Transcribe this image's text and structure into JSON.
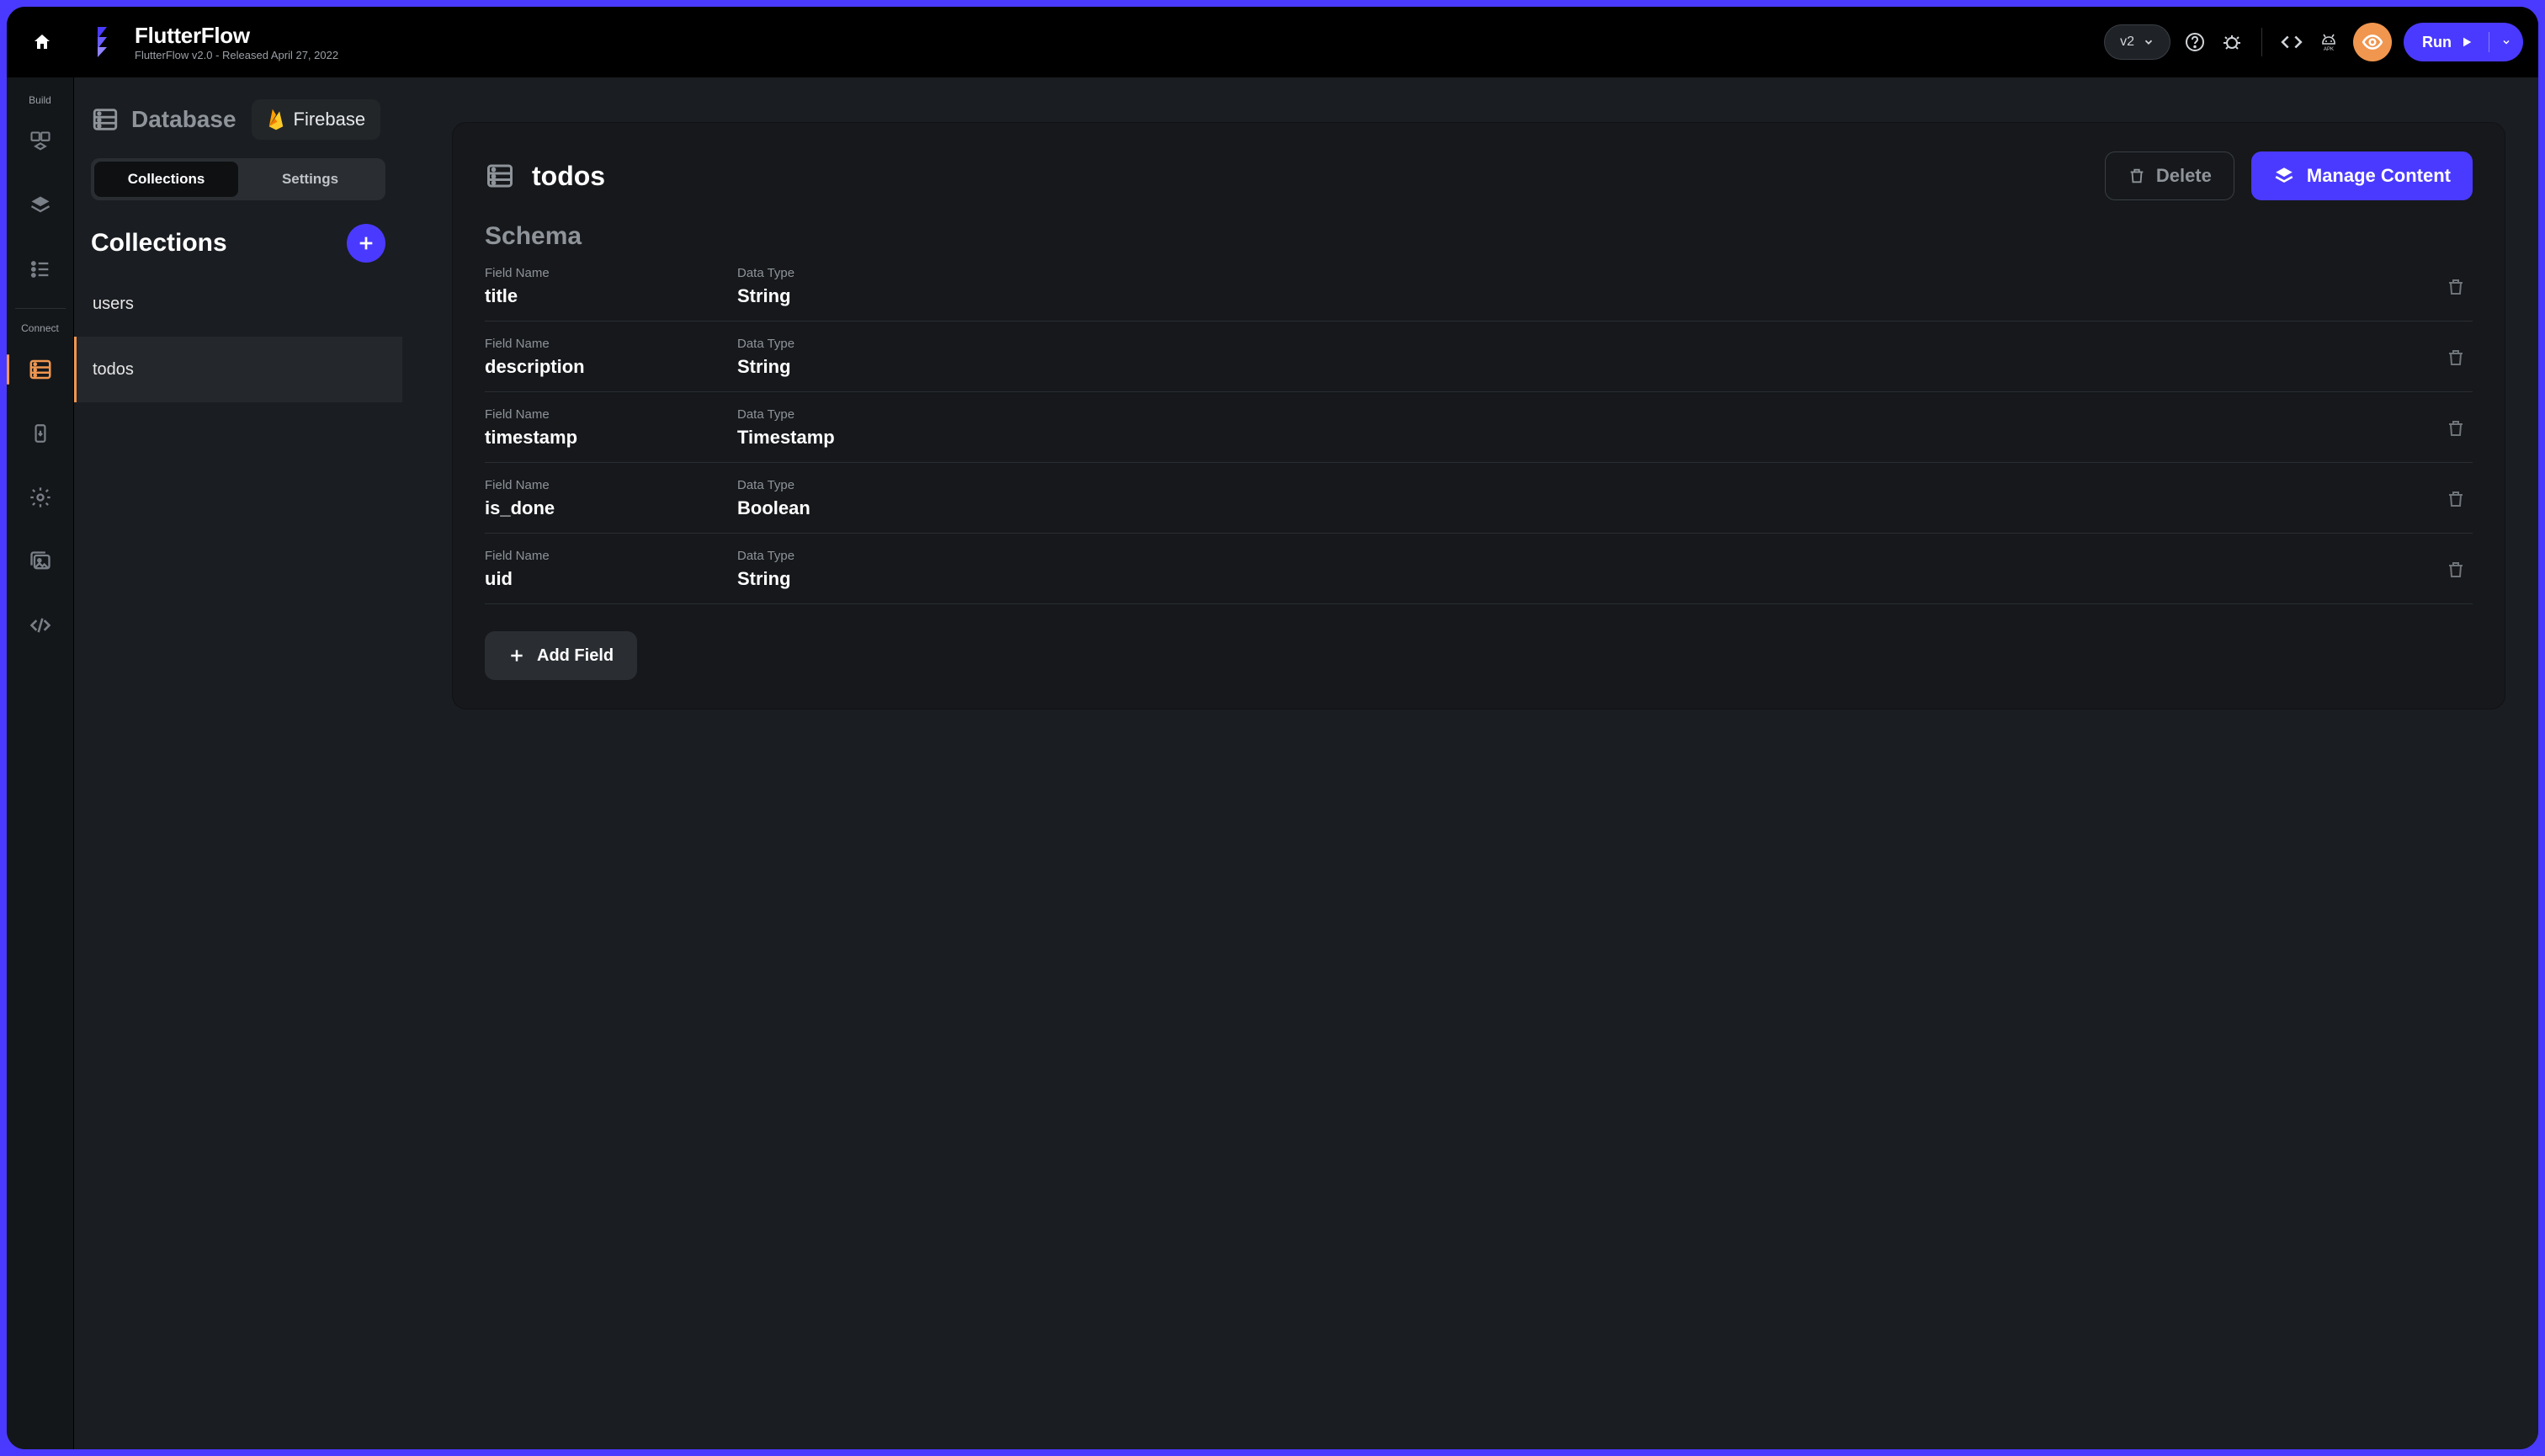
{
  "header": {
    "title": "FlutterFlow",
    "subtitle": "FlutterFlow v2.0 - Released April 27, 2022",
    "version_label": "v2",
    "run_label": "Run"
  },
  "rail": {
    "section1": "Build",
    "section2": "Connect"
  },
  "sidebar": {
    "title": "Database",
    "provider": "Firebase",
    "tabs": {
      "collections": "Collections",
      "settings": "Settings"
    },
    "collections_heading": "Collections",
    "items": [
      {
        "name": "users"
      },
      {
        "name": "todos"
      }
    ]
  },
  "main": {
    "collection_name": "todos",
    "delete_label": "Delete",
    "manage_label": "Manage Content",
    "schema_heading": "Schema",
    "field_name_label": "Field Name",
    "data_type_label": "Data Type",
    "add_field_label": "Add Field",
    "fields": [
      {
        "name": "title",
        "type": "String"
      },
      {
        "name": "description",
        "type": "String"
      },
      {
        "name": "timestamp",
        "type": "Timestamp"
      },
      {
        "name": "is_done",
        "type": "Boolean"
      },
      {
        "name": "uid",
        "type": "String"
      }
    ]
  }
}
